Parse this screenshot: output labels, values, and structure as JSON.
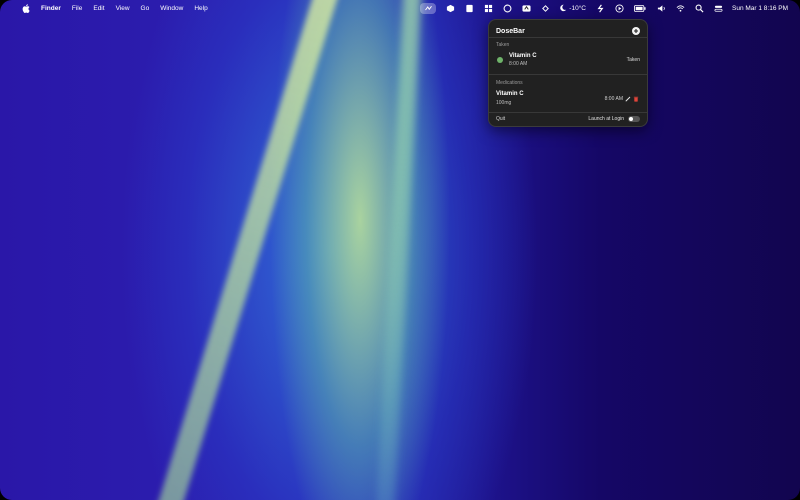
{
  "menubar": {
    "app_name": "Finder",
    "menus": [
      "File",
      "Edit",
      "View",
      "Go",
      "Window",
      "Help"
    ],
    "weather": "-10°C",
    "datetime": "Sun Mar 1  8:16 PM"
  },
  "popover": {
    "title": "DoseBar",
    "taken_section": "Taken",
    "taken": [
      {
        "name": "Vitamin C",
        "time": "8:00 AM",
        "status": "Taken"
      }
    ],
    "medications_section": "Medications",
    "medications": [
      {
        "name": "Vitamin C",
        "dose": "100mg",
        "time": "8:00 AM"
      }
    ],
    "quit_label": "Quit",
    "launch_label": "Launch at Login",
    "launch_enabled": false
  },
  "colors": {
    "accent_green": "#6fb46a",
    "delete_red": "#e0443a",
    "popover_bg": "#212121"
  }
}
